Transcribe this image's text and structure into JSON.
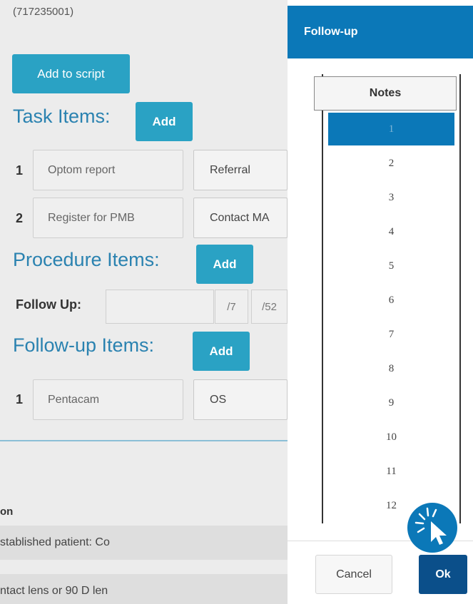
{
  "background": {
    "code": "(717235001)",
    "add_to_script": "Add to script",
    "task_items_title": "Task Items:",
    "task_add": "Add",
    "task_rows": [
      {
        "num": "1",
        "field": "Optom report",
        "select": "Referral"
      },
      {
        "num": "2",
        "field": "Register for PMB",
        "select": "Contact MA"
      }
    ],
    "procedure_items_title": "Procedure Items:",
    "procedure_add": "Add",
    "follow_up_label": "Follow Up:",
    "follow_up_units": [
      "/7",
      "/52"
    ],
    "followup_items_title": "Follow-up Items:",
    "followup_add": "Add",
    "followup_rows": [
      {
        "num": "1",
        "field": "Pentacam",
        "select": "OS"
      }
    ],
    "table_col_head": "on",
    "table_rows": [
      "stablished patient: Co",
      "ntact lens or 90 D len"
    ]
  },
  "modal": {
    "title": "Follow-up",
    "list_header": "Notes",
    "items": [
      "1",
      "2",
      "3",
      "4",
      "5",
      "6",
      "7",
      "8",
      "9",
      "10",
      "11",
      "12"
    ],
    "selected_index": 0,
    "cancel_label": "Cancel",
    "ok_label": "Ok",
    "click_indicator_icon": "cursor-click-icon"
  },
  "colors": {
    "modal_header": "#0b78b8",
    "ok_button": "#0b4f8a",
    "add_button": "#2aa2c4",
    "section_title": "#2a82b0"
  }
}
